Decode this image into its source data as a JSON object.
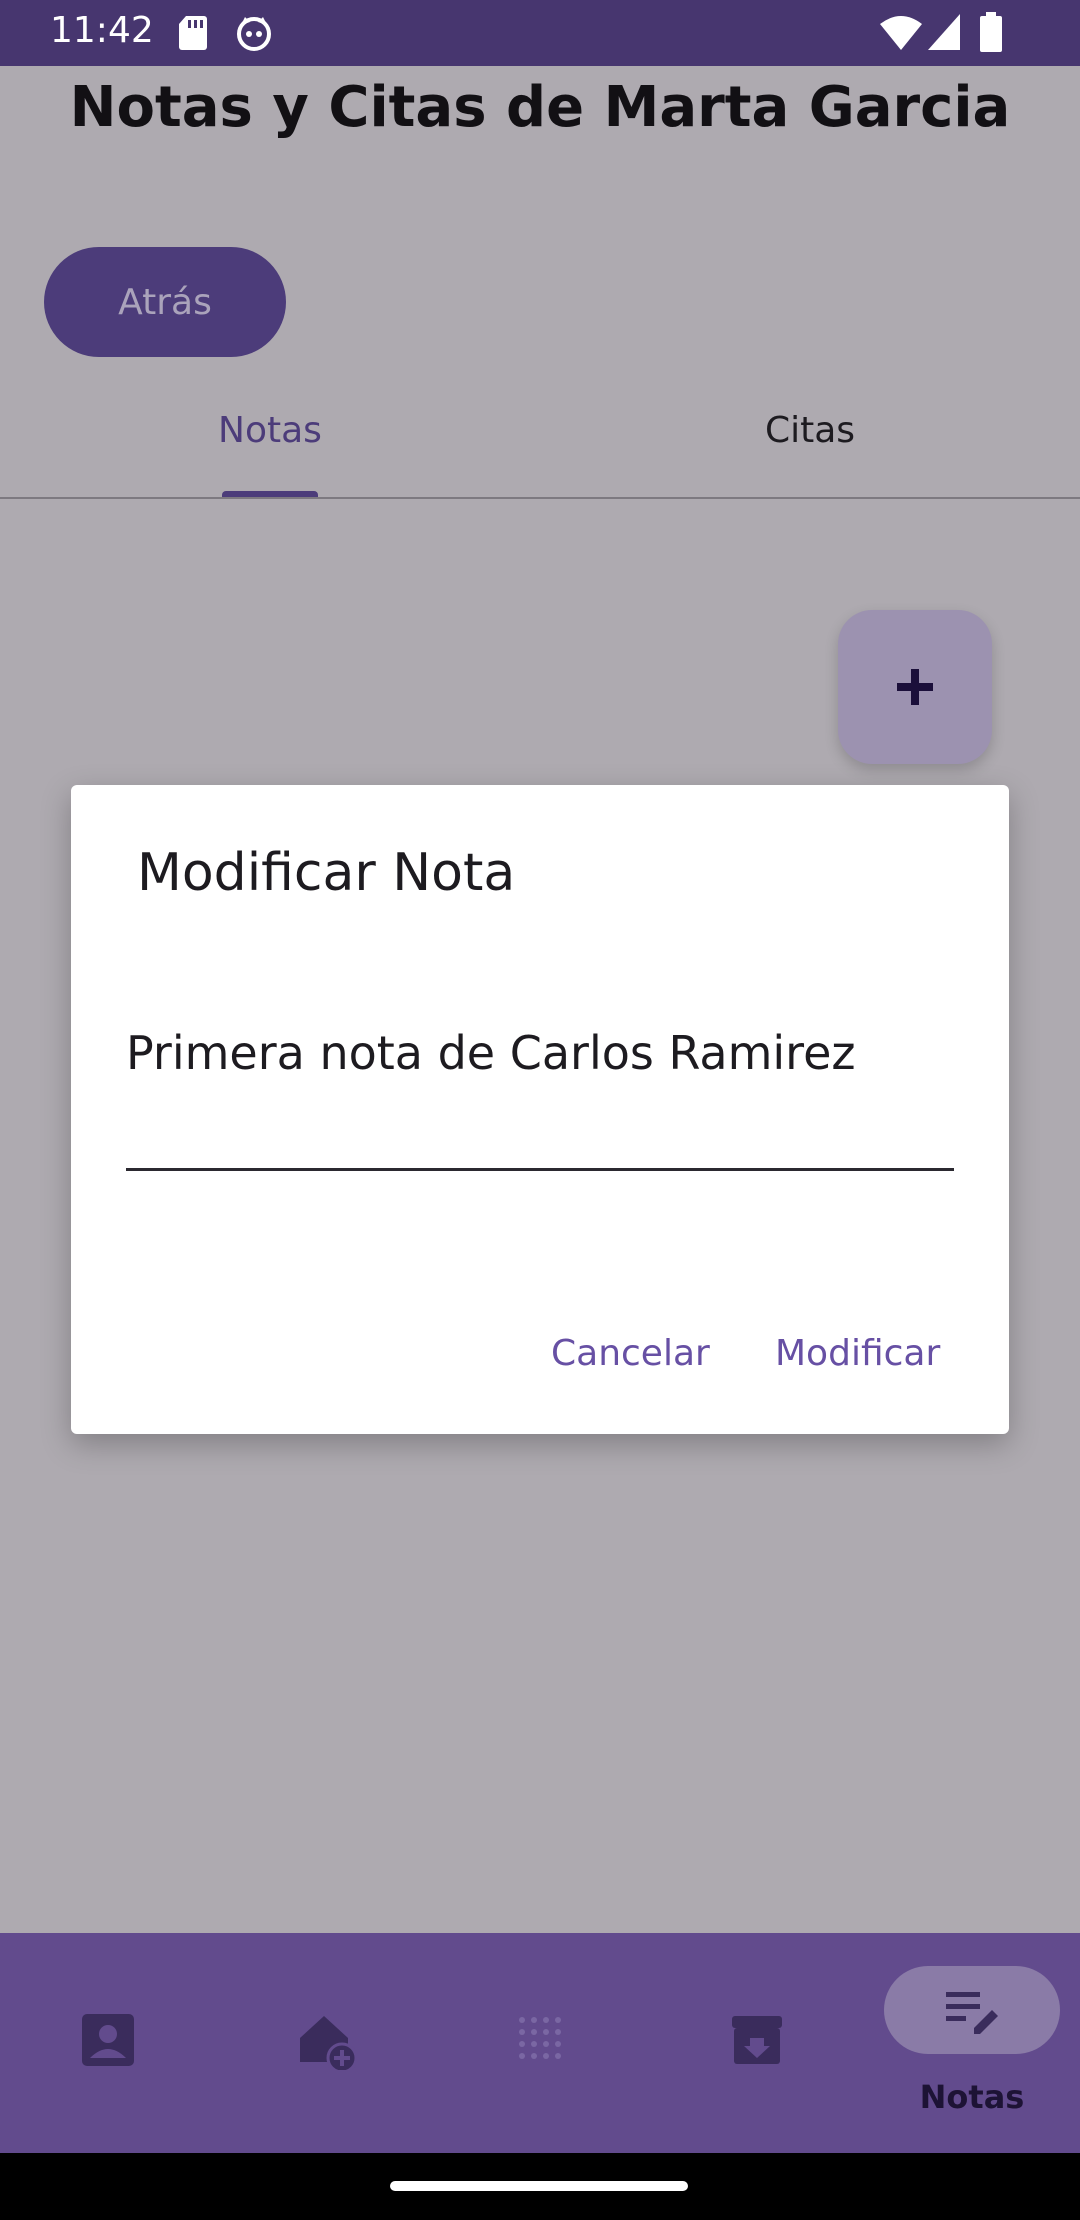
{
  "status_bar": {
    "time": "11:42",
    "icons": [
      "sd-card-icon",
      "cat-face-icon",
      "wifi-icon",
      "signal-icon",
      "battery-icon"
    ]
  },
  "header": {
    "title": "Notas y Citas de Marta Garcia",
    "back_label": "Atrás"
  },
  "tabs": [
    {
      "label": "Notas",
      "selected": true
    },
    {
      "label": "Citas",
      "selected": false
    }
  ],
  "fab": {
    "icon": "plus-icon"
  },
  "dialog": {
    "title": "Modificar Nota",
    "input_value": "Primera nota de Carlos Ramirez",
    "cancel_label": "Cancelar",
    "confirm_label": "Modificar"
  },
  "bottom_nav": {
    "items": [
      {
        "icon": "contact-icon"
      },
      {
        "icon": "add-home-icon"
      },
      {
        "icon": "dots-grid-icon"
      },
      {
        "icon": "archive-download-icon"
      },
      {
        "icon": "edit-notes-icon",
        "label": "Notas",
        "active": true
      }
    ]
  },
  "colors": {
    "primary": "#4c3c7a",
    "accent": "#6750a4",
    "nav_bg": "#624b8d",
    "status_bar": "#47366f"
  }
}
